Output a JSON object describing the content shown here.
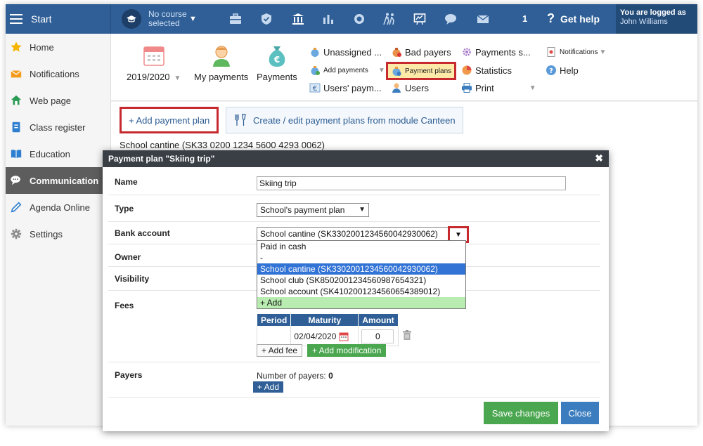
{
  "topbar": {
    "start_label": "Start",
    "course_label": "No course selected",
    "mail_count": "1",
    "help_label": "Get help",
    "logged_as_label": "You are logged as",
    "user_name": "John Williams"
  },
  "sidebar": {
    "items": [
      {
        "label": "Home",
        "icon": "star-icon"
      },
      {
        "label": "Notifications",
        "icon": "envelope-icon"
      },
      {
        "label": "Web page",
        "icon": "house-icon"
      },
      {
        "label": "Class register",
        "icon": "register-icon"
      },
      {
        "label": "Education",
        "icon": "book-icon"
      },
      {
        "label": "Communication",
        "icon": "chat-icon",
        "active": true
      },
      {
        "label": "Agenda Online",
        "icon": "pen-icon"
      },
      {
        "label": "Settings",
        "icon": "gear-icon"
      }
    ]
  },
  "ribbon": {
    "year": "2019/2020",
    "my_payments": "My payments",
    "payments": "Payments",
    "unassigned": "Unassigned ...",
    "add_payments": "Add payments",
    "users_payments": "Users' paym...",
    "bad_payers": "Bad payers",
    "payment_plans": "Payment plans",
    "users": "Users",
    "payments_s": "Payments s...",
    "statistics": "Statistics",
    "print": "Print",
    "notifications": "Notifications",
    "help": "Help"
  },
  "content": {
    "add_plan_label": "+ Add payment plan",
    "canteen_label": "Create / edit payment plans from module Canteen",
    "cantine_account_label": "School cantine (SK33 0200 1234 5600 4293 0062)"
  },
  "modal": {
    "title": "Payment plan \"Skiing trip\"",
    "labels": {
      "name": "Name",
      "type": "Type",
      "bank_account": "Bank account",
      "owner": "Owner",
      "visibility": "Visibility",
      "fees": "Fees",
      "payers": "Payers"
    },
    "name_value": "Skiing trip",
    "type_value": "School's payment plan",
    "bank_value": "School cantine (SK3302001234560042930062)",
    "bank_options": [
      "Paid in cash",
      "-",
      "School cantine (SK3302001234560042930062)",
      "School club (SK8502001234560987654321)",
      "School account (SK4102001234560654389012)",
      "+ Add"
    ],
    "fees_table": {
      "headers": [
        "Period",
        "Maturity",
        "Amount"
      ],
      "row": {
        "period": "",
        "maturity": "02/04/2020",
        "amount": "0"
      }
    },
    "add_fee_label": "+ Add fee",
    "add_modification_label": "+ Add modification",
    "payers_count_label": "Number of payers:",
    "payers_count": "0",
    "payers_add_label": "+ Add",
    "save_label": "Save changes",
    "close_label": "Close"
  }
}
